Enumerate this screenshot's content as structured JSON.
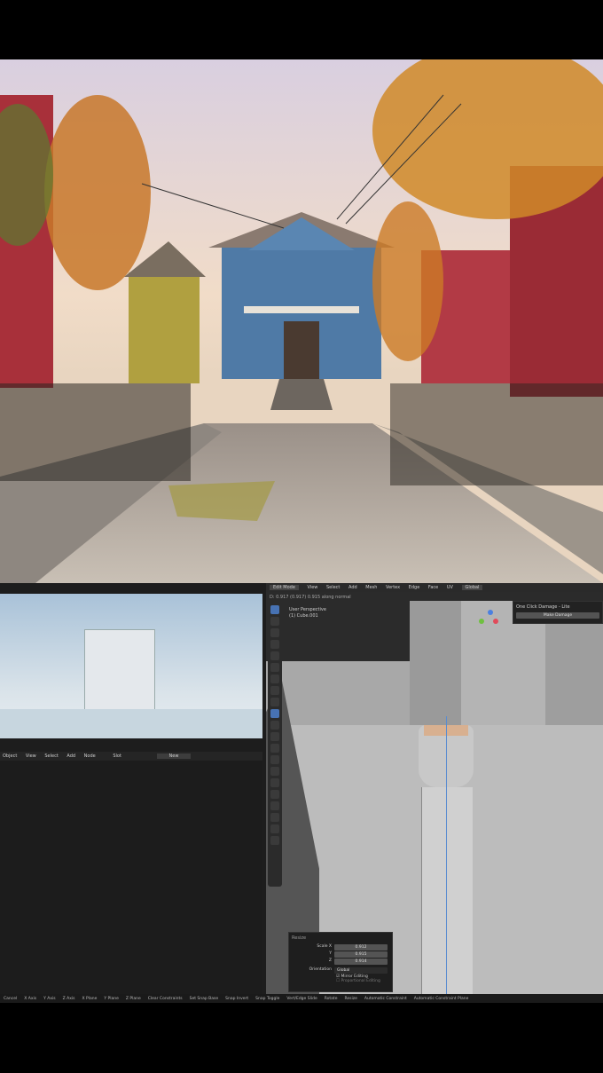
{
  "compositor": {
    "header": {
      "mode": "Object",
      "menus": [
        "View",
        "Select",
        "Add",
        "Node"
      ],
      "slot": "Slot",
      "new_label": "New"
    }
  },
  "viewport": {
    "header": {
      "mode": "Edit Mode",
      "menus": [
        "View",
        "Select",
        "Add",
        "Mesh",
        "Vertex",
        "Edge",
        "Face",
        "UV"
      ],
      "orientation": "Global"
    },
    "info_line": "D: 0.917 (0.917) 0.915 along normal",
    "perspective": "User Perspective",
    "object": "(1) Cube.001",
    "addon_panel": {
      "title": "One Click Damage - Lite",
      "button": "Make Damage"
    },
    "redo_panel": {
      "title": "Resize",
      "labels": [
        "Scale X",
        "Y",
        "Z"
      ],
      "values": [
        "0.912",
        "0.915",
        "0.914"
      ],
      "orientation_label": "Orientation",
      "orientation_value": "Global",
      "mirror_editing": "Mirror Editing",
      "proportional_editing": "Proportional Editing"
    }
  },
  "statusbar": [
    "Cancel",
    "X Axis",
    "Y Axis",
    "Z Axis",
    "X Plane",
    "Y Plane",
    "Z Plane",
    "Clear Constraints",
    "Set Snap Base",
    "Snap Invert",
    "Snap Toggle",
    "Vert/Edge Slide",
    "Rotate",
    "Resize",
    "Automatic Constraint",
    "Automatic Constraint Plane"
  ],
  "colors": {
    "accent": "#4772b3",
    "panel": "#1d1d1d"
  }
}
